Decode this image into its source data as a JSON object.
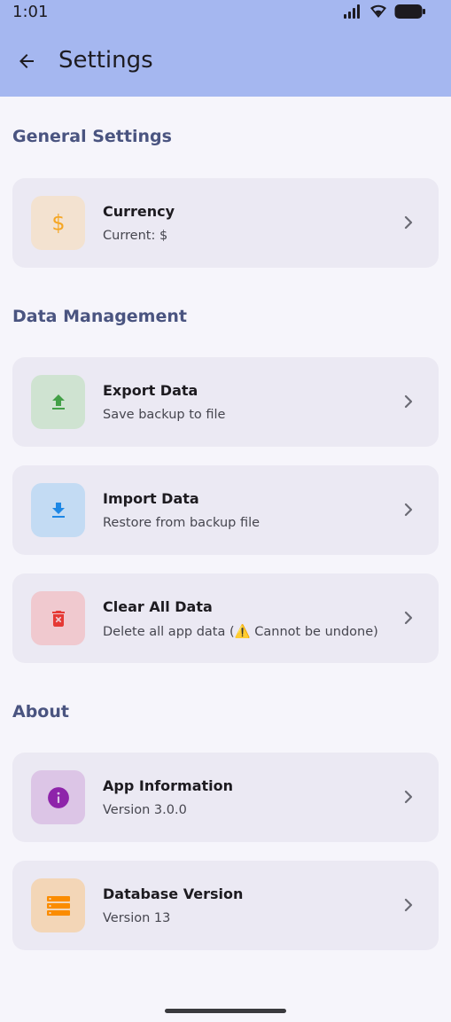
{
  "status_bar": {
    "time": "1:01"
  },
  "app_bar": {
    "title": "Settings"
  },
  "sections": {
    "general": {
      "title": "General Settings"
    },
    "data": {
      "title": "Data Management"
    },
    "about": {
      "title": "About"
    }
  },
  "items": {
    "currency": {
      "title": "Currency",
      "subtitle": "Current: $",
      "icon": "dollar-icon",
      "icon_bg": "#f3e2d0",
      "icon_color": "#f5a623"
    },
    "export": {
      "title": "Export Data",
      "subtitle": "Save backup to file",
      "icon": "upload-icon",
      "icon_bg": "#cfe3d1",
      "icon_color": "#43a047"
    },
    "import": {
      "title": "Import Data",
      "subtitle": "Restore from backup file",
      "icon": "download-icon",
      "icon_bg": "#c3dbf3",
      "icon_color": "#1e88e5"
    },
    "clear": {
      "title": "Clear All Data",
      "subtitle": "Delete all app data (⚠️ Cannot be undone)",
      "icon": "trash-icon",
      "icon_bg": "#f0c9cf",
      "icon_color": "#e53935"
    },
    "app_info": {
      "title": "App Information",
      "subtitle": "Version 3.0.0",
      "icon": "info-icon",
      "icon_bg": "#dcc5e6",
      "icon_color": "#8e24aa"
    },
    "db_version": {
      "title": "Database Version",
      "subtitle": "Version 13",
      "icon": "storage-icon",
      "icon_bg": "#f3d6b7",
      "icon_color": "#fb8c00"
    }
  },
  "colors": {
    "app_bar_bg": "#a5b7f0",
    "section_title": "#4a5480",
    "card_bg": "#ebe9f3",
    "page_bg": "#f6f5fb"
  }
}
